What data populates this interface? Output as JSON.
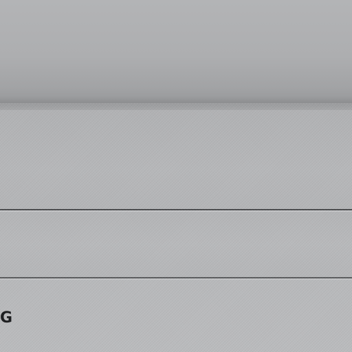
{
  "scene": {
    "description_colors": {
      "surface": "#b2b3b5",
      "seam": "#4a4b4d",
      "text": "#1e1f21"
    },
    "visible_text": "G"
  }
}
